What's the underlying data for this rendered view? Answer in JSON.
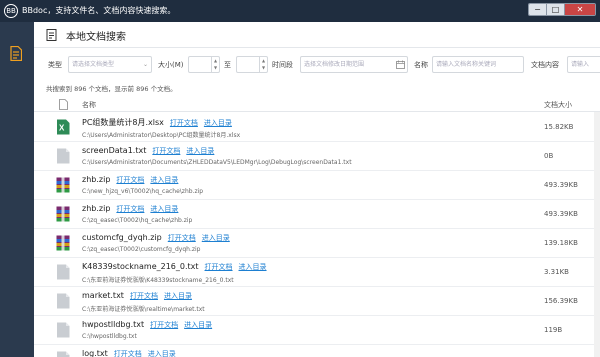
{
  "window": {
    "logo_text": "BB",
    "title": "BBdoc，支持文件名、文档内容快速搜索。",
    "minimize": "−",
    "restore": "□",
    "close": "✕"
  },
  "page": {
    "title": "本地文档搜索"
  },
  "filters": {
    "type_label": "类型",
    "type_placeholder": "请选择文档类型",
    "size_label": "大小(M)",
    "size_to": "至",
    "time_label": "时间段",
    "time_placeholder": "选择文档修改日期范围",
    "name_label": "名称",
    "name_placeholder": "请输入文档名称关键词",
    "content_label": "文档内容",
    "content_placeholder": "请输入"
  },
  "summary": "共搜索到 896 个文档，显示前 896 个文档。",
  "columns": {
    "name": "名称",
    "size": "文档大小"
  },
  "links": {
    "open": "打开文档",
    "dir": "进入目录"
  },
  "rows": [
    {
      "icon": "excel-icon",
      "name": "PC组数量统计8月.xlsx",
      "path": "C:\\Users\\Administrator\\Desktop\\PC组数量统计8月.xlsx",
      "size": "15.82KB"
    },
    {
      "icon": "text-file-icon",
      "name": "screenData1.txt",
      "path": "C:\\Users\\Administrator\\Documents\\ZHLEDDataV5\\LEDMgr\\Log\\DebugLog\\screenData1.txt",
      "size": "0B"
    },
    {
      "icon": "zip-icon",
      "name": "zhb.zip",
      "path": "C:\\new_hjzq_v6\\T0002\\hq_cache\\zhb.zip",
      "size": "493.39KB"
    },
    {
      "icon": "zip-icon",
      "name": "zhb.zip",
      "path": "C:\\zq_easec\\T0002\\hq_cache\\zhb.zip",
      "size": "493.39KB"
    },
    {
      "icon": "zip-icon",
      "name": "customcfg_dyqh.zip",
      "path": "C:\\zq_easec\\T0002\\customcfg_dyqh.zip",
      "size": "139.18KB"
    },
    {
      "icon": "text-file-icon",
      "name": "K48339stockname_216_0.txt",
      "path": "C:\\东亚前海证券悦涨版\\K48339stockname_216_0.txt",
      "size": "3.31KB"
    },
    {
      "icon": "text-file-icon",
      "name": "market.txt",
      "path": "C:\\东亚前海证券悦涨版\\realtime\\market.txt",
      "size": "156.39KB"
    },
    {
      "icon": "text-file-icon",
      "name": "hwpostlldbg.txt",
      "path": "C:\\hwpostlldbg.txt",
      "size": "119B"
    },
    {
      "icon": "text-file-icon",
      "name": "log.txt",
      "path": "",
      "size": ""
    }
  ],
  "colors": {
    "accent": "#1d7fd1",
    "titlebar": "#1f2d3f",
    "sidebar": "#2b3a4e",
    "sidebar_icon": "#f0a020"
  }
}
